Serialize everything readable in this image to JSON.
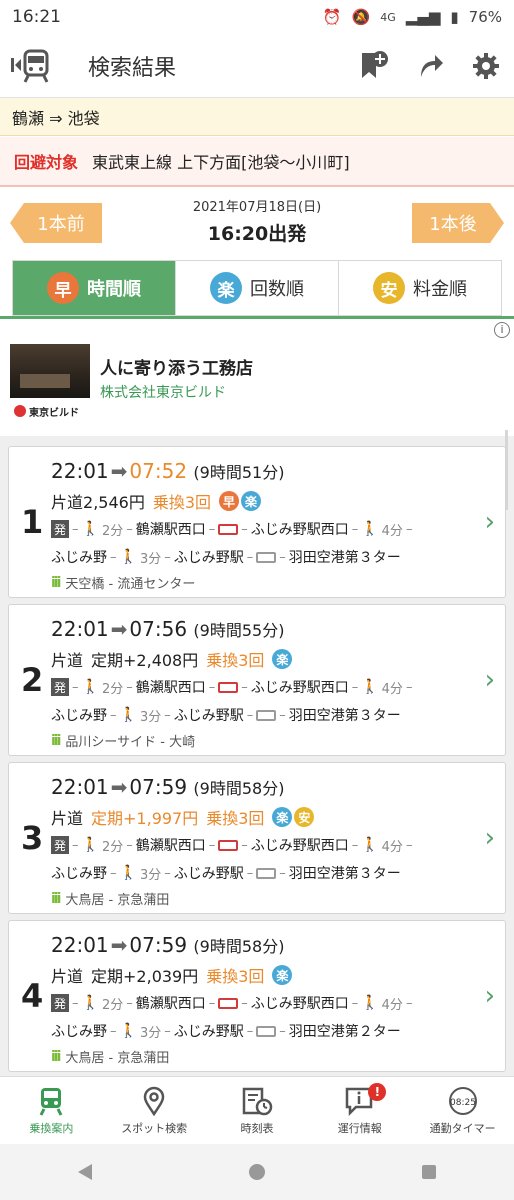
{
  "status_bar": {
    "time": "16:21",
    "network": "4G",
    "battery": "76%"
  },
  "header": {
    "title": "検索結果"
  },
  "route": {
    "text": "鶴瀬 ⇒ 池袋"
  },
  "avoid": {
    "label": "回避対象",
    "text": "東武東上線 上下方面[池袋～小川町]"
  },
  "datetime": {
    "date": "2021年07月18日(日)",
    "departure": "16:20出発",
    "prev_label": "1本前",
    "next_label": "1本後"
  },
  "sort_tabs": [
    {
      "badge": "早",
      "label": "時間順",
      "color": "#e9763a",
      "active": true
    },
    {
      "badge": "楽",
      "label": "回数順",
      "color": "#48a9d6",
      "active": false
    },
    {
      "badge": "安",
      "label": "料金順",
      "color": "#e8b62a",
      "active": false
    }
  ],
  "ad": {
    "headline": "人に寄り添う工務店",
    "advertiser": "株式会社東京ビルド",
    "logo_text": "東京ビルド"
  },
  "results": [
    {
      "index": "1",
      "dep": "22:01",
      "arr": "07:52",
      "duration": "(9時間51分)",
      "fare_prefix": "片道",
      "fare": "2,546円",
      "transfers": "乗換3回",
      "badges": [
        "早",
        "楽"
      ],
      "row1": {
        "walk1": "2分",
        "stop1": "鶴瀬駅西口",
        "stop2": "ふじみ野駅西口",
        "walk2": "4分"
      },
      "row2": {
        "stop0": "ふじみ野",
        "walk": "3分",
        "stop1": "ふじみ野駅",
        "stop2": "羽田空港第３ター"
      },
      "crowd": "天空橋 - 流通センター"
    },
    {
      "index": "2",
      "dep": "22:01",
      "arr": "07:56",
      "duration": "(9時間55分)",
      "fare_prefix": "片道",
      "fare": "定期+2,408円",
      "transfers": "乗換3回",
      "badges": [
        "楽"
      ],
      "row1": {
        "walk1": "2分",
        "stop1": "鶴瀬駅西口",
        "stop2": "ふじみ野駅西口",
        "walk2": "4分"
      },
      "row2": {
        "stop0": "ふじみ野",
        "walk": "3分",
        "stop1": "ふじみ野駅",
        "stop2": "羽田空港第３ター"
      },
      "crowd": "品川シーサイド - 大崎"
    },
    {
      "index": "3",
      "dep": "22:01",
      "arr": "07:59",
      "duration": "(9時間58分)",
      "fare_prefix": "片道",
      "fare": "定期+1,997円",
      "transfers": "乗換3回",
      "badges": [
        "楽",
        "安"
      ],
      "row1": {
        "walk1": "2分",
        "stop1": "鶴瀬駅西口",
        "stop2": "ふじみ野駅西口",
        "walk2": "4分"
      },
      "row2": {
        "stop0": "ふじみ野",
        "walk": "3分",
        "stop1": "ふじみ野駅",
        "stop2": "羽田空港第３ター"
      },
      "crowd": "大鳥居 - 京急蒲田"
    },
    {
      "index": "4",
      "dep": "22:01",
      "arr": "07:59",
      "duration": "(9時間58分)",
      "fare_prefix": "片道",
      "fare": "定期+2,039円",
      "transfers": "乗換3回",
      "badges": [
        "楽"
      ],
      "row1": {
        "walk1": "2分",
        "stop1": "鶴瀬駅西口",
        "stop2": "ふじみ野駅西口",
        "walk2": "4分"
      },
      "row2": {
        "stop0": "ふじみ野",
        "walk": "3分",
        "stop1": "ふじみ野駅",
        "stop2": "羽田空港第２ター"
      },
      "crowd": "大鳥居 - 京急蒲田"
    }
  ],
  "bottom_nav": [
    {
      "label": "乗換案内",
      "icon": "train-icon",
      "active": true
    },
    {
      "label": "スポット検索",
      "icon": "map-pin-icon",
      "active": false
    },
    {
      "label": "時刻表",
      "icon": "timetable-icon",
      "active": false
    },
    {
      "label": "運行情報",
      "icon": "service-info-icon",
      "active": false,
      "alert": "!"
    },
    {
      "label": "通勤タイマー",
      "icon": "commute-timer-icon",
      "active": false,
      "clock": "08:25"
    }
  ],
  "colors": {
    "brand_green": "#5aa86a",
    "accent_orange": "#f5b96e",
    "alert_red": "#e0302a"
  }
}
